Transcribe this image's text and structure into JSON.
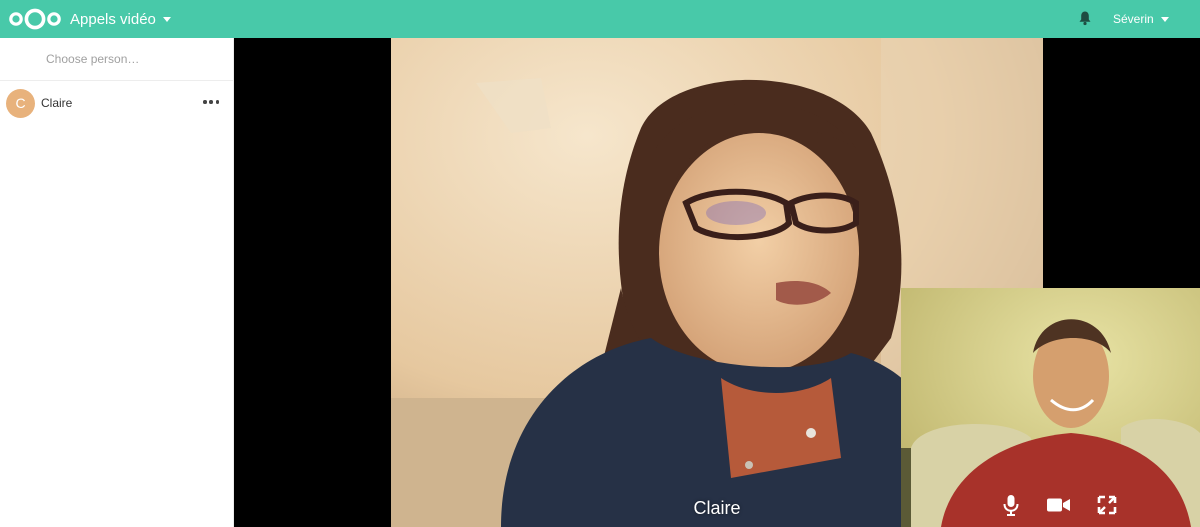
{
  "header": {
    "app_title": "Appels vidéo",
    "user_name": "Séverin",
    "brand_color": "#48c9a9"
  },
  "sidebar": {
    "search_placeholder": "Choose person…",
    "contacts": [
      {
        "name": "Claire",
        "initial": "C",
        "avatar_color": "#e8b27c"
      }
    ]
  },
  "call": {
    "remote_participant": "Claire"
  },
  "icons": {
    "logo": "nextcloud-logo",
    "notifications": "bell-icon",
    "app_menu": "caret-down-icon",
    "contact_actions": "more-dots-icon",
    "mic": "microphone-icon",
    "camera": "video-camera-icon",
    "fullscreen": "fullscreen-icon"
  }
}
